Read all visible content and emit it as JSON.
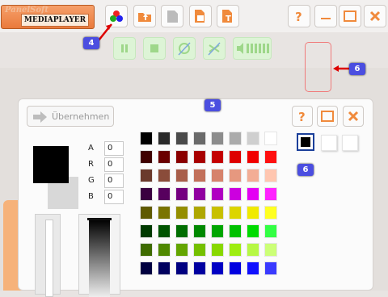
{
  "logo": {
    "text": "MEDIAPLAYER",
    "script_text": "PanelSoft"
  },
  "toolbar": {
    "icons": [
      "colors-icon",
      "open-folder-icon",
      "disabled-file-icon",
      "image-file-icon",
      "text-file-icon"
    ],
    "window_icons": [
      "help-icon",
      "minimize-icon",
      "maximize-icon",
      "close-icon"
    ]
  },
  "player_controls": [
    "pause-icon",
    "stop-icon",
    "repeat-icon",
    "shuffle-icon",
    "volume-icon"
  ],
  "badges": {
    "b4": "4",
    "b5": "5",
    "b6a": "6",
    "b6b": "6"
  },
  "panel": {
    "apply_label": "Übernehmen",
    "argb": [
      {
        "label": "A",
        "value": "0"
      },
      {
        "label": "R",
        "value": "0"
      },
      {
        "label": "G",
        "value": "0"
      },
      {
        "label": "B",
        "value": "0"
      }
    ],
    "palette": [
      [
        "#000000",
        "#2a2a2a",
        "#4a4a4a",
        "#6a6a6a",
        "#8c8c8c",
        "#ababab",
        "#cfcfcf",
        "#ffffff"
      ],
      [
        "#3f0000",
        "#6a0000",
        "#8a0000",
        "#a80000",
        "#c40000",
        "#de0000",
        "#f10000",
        "#ff1010"
      ],
      [
        "#6b3a2c",
        "#8a4c3a",
        "#a85e4a",
        "#c2705a",
        "#d6836c",
        "#e6987f",
        "#f3ad95",
        "#ffc6b0"
      ],
      [
        "#3a0040",
        "#57005e",
        "#750080",
        "#9100a0",
        "#b000c2",
        "#cc00df",
        "#e400f4",
        "#ff22ff"
      ],
      [
        "#5f5a00",
        "#7a7400",
        "#948e00",
        "#aea700",
        "#c8c000",
        "#dcd500",
        "#f0ea00",
        "#ffff22"
      ],
      [
        "#003a00",
        "#005400",
        "#006e00",
        "#008900",
        "#00a600",
        "#00c100",
        "#00db00",
        "#33ff44"
      ],
      [
        "#3e6b00",
        "#4f8800",
        "#63a500",
        "#75c000",
        "#88d800",
        "#9ded10",
        "#b6f844",
        "#ccff77"
      ],
      [
        "#000040",
        "#00005e",
        "#000080",
        "#0000a0",
        "#0000c4",
        "#0000e0",
        "#1010ff",
        "#3a3aff"
      ]
    ],
    "selected_color": "#000000"
  }
}
